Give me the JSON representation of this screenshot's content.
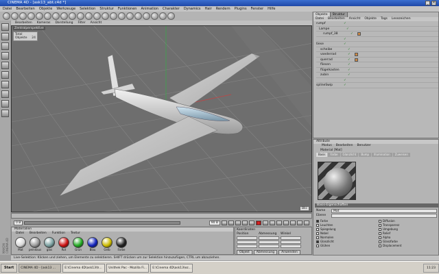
{
  "window": {
    "title": "CINEMA 4D - [ask13_abt.c4d *]"
  },
  "menubar": {
    "items": [
      "Datei",
      "Bearbeiten",
      "Objekte",
      "Werkzeuge",
      "Selektion",
      "Struktur",
      "Funktionen",
      "Animation",
      "Charakter",
      "Dynamics",
      "Hair",
      "Rendern",
      "Plugins",
      "Fenster",
      "Hilfe"
    ]
  },
  "viewport": {
    "menu": [
      "Bearbeiten",
      "Kameras",
      "Darstellung",
      "Filter",
      "Ansicht"
    ],
    "label": "Zentralperspektive",
    "info_title": "Total",
    "info_label": "Objekte",
    "info_value": "24",
    "corner_label": "Blic"
  },
  "transport": {
    "start_frame": "0 B",
    "end_frame": "90 B"
  },
  "materials": {
    "title": "Materialien",
    "menu": [
      "Datei",
      "Bearbeiten",
      "Funktion",
      "Textur"
    ],
    "items": [
      {
        "name": "Mat",
        "color": "#d8d8d8"
      },
      {
        "name": "peindaus",
        "color": "#9a9a9a"
      },
      {
        "name": "glas",
        "color": "#7aa0a0"
      },
      {
        "name": "Rot",
        "color": "#cc1111"
      },
      {
        "name": "Grün",
        "color": "#22aa22"
      },
      {
        "name": "Blau",
        "color": "#1122bb"
      },
      {
        "name": "Gelb",
        "color": "#ccbb00"
      },
      {
        "name": "Farbe",
        "color": "#222222"
      }
    ]
  },
  "coordinates": {
    "title": "Koordinaten",
    "row_labels": [
      "Position",
      "Abmessung",
      "Winkel"
    ],
    "object_button": "Objekt",
    "size_button": "Abmessung",
    "apply_button": "Anwenden"
  },
  "objects": {
    "tabs": [
      "Objekte",
      "Struktur"
    ],
    "menu": [
      "Datei",
      "Bearbeiten",
      "Ansicht",
      "Objekte",
      "Tags",
      "Lesezeichen"
    ],
    "rows": [
      {
        "name": "rumpf",
        "has_tag": false
      },
      {
        "name": "Lampe",
        "has_tag": false
      },
      {
        "name": "rumpf_38",
        "has_tag": true
      },
      {
        "name": "",
        "has_tag": false
      },
      {
        "name": "tiese",
        "has_tag": false
      },
      {
        "name": "scheibe",
        "has_tag": false
      },
      {
        "name": "voederrad",
        "has_tag": true
      },
      {
        "name": "querrad",
        "has_tag": true
      },
      {
        "name": "fliesen",
        "has_tag": false
      },
      {
        "name": "flügelkasten",
        "has_tag": false
      },
      {
        "name": "zubin",
        "has_tag": false
      },
      {
        "name": "",
        "has_tag": false
      },
      {
        "name": "splineSwip",
        "has_tag": false
      }
    ]
  },
  "attributes": {
    "title": "Attribute",
    "menu": [
      "Modus",
      "Bearbeiten",
      "Benutzer"
    ],
    "material_name": "Material [Mat]",
    "subtabs": [
      "Basis",
      "Farbe",
      "Glanzlicht",
      "Bump",
      "Illumination",
      "Zuweisen"
    ],
    "section": "Basis-Eigenschaften",
    "name_label": "Name",
    "name_value": "Mat",
    "layer_label": "Ebene",
    "channels": [
      {
        "name": "Farbe",
        "on": true
      },
      {
        "name": "Diffusion",
        "on": false
      },
      {
        "name": "Leuchten",
        "on": false
      },
      {
        "name": "Transparenz",
        "on": false
      },
      {
        "name": "Spiegelung",
        "on": false
      },
      {
        "name": "Umgebung",
        "on": false
      },
      {
        "name": "Nebel",
        "on": false
      },
      {
        "name": "Relief",
        "on": false
      },
      {
        "name": "Normalen",
        "on": false
      },
      {
        "name": "Alpha",
        "on": false
      },
      {
        "name": "Glanzlicht",
        "on": true
      },
      {
        "name": "Glanzfarbe",
        "on": false
      },
      {
        "name": "Glühen",
        "on": false
      },
      {
        "name": "Displacement",
        "on": false
      }
    ]
  },
  "statusbar": {
    "text": "Live-Selektion: Klicken und ziehen, um Elemente zu selektieren. SHIFT drücken um zur Selektion hinzuzufügen, CTRL um abzuziehen."
  },
  "taskbar": {
    "start_label": "Start",
    "tasks": [
      "CINEMA 4D - [ask13 ...",
      "E:\\Cinema 4D\\ask13\\h...",
      "Unithek Pac - Mozilla Fi...",
      "E:\\Cinema 4D\\ask13\\ez..."
    ],
    "clock": "11:23"
  },
  "maxon": "MAXON CINEMA 4D"
}
